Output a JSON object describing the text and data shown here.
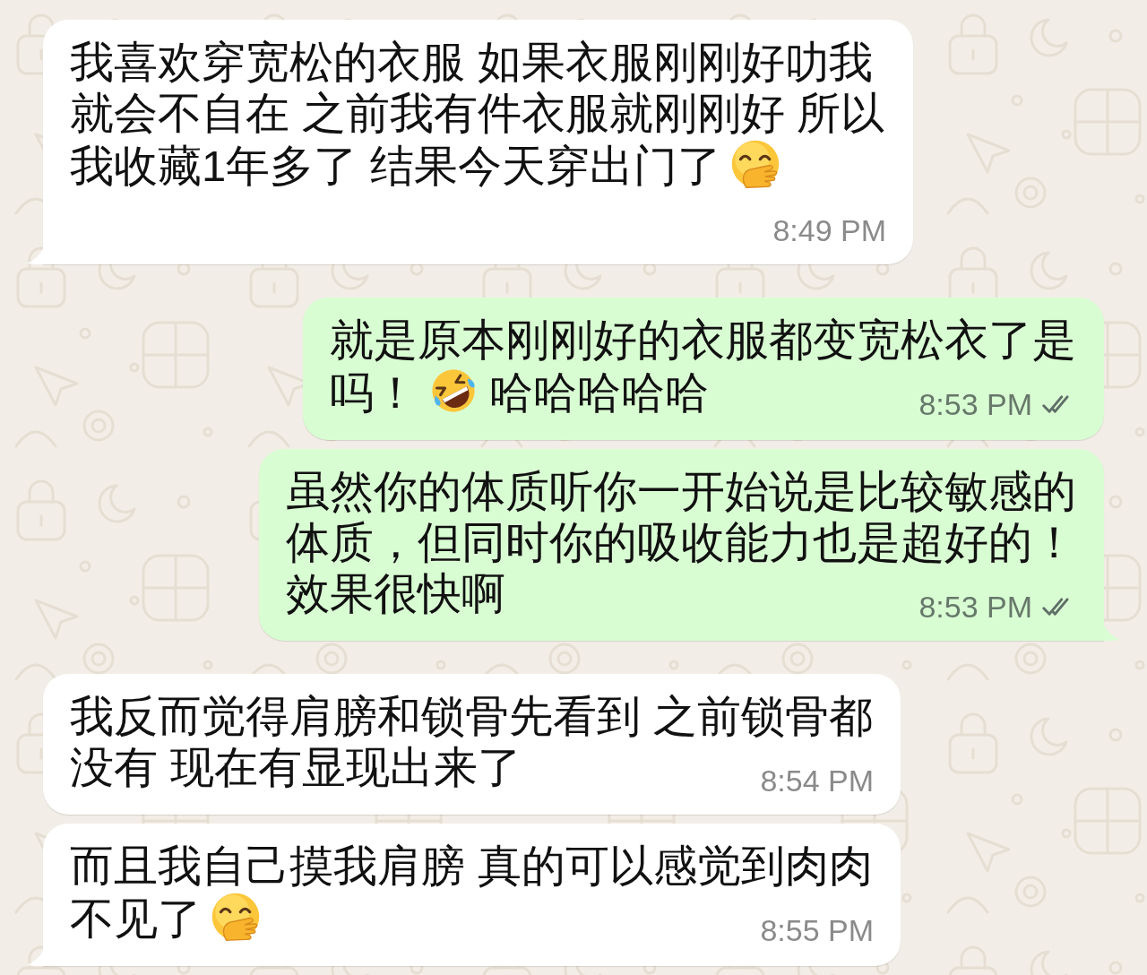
{
  "chat": {
    "messages": [
      {
        "kind": "incoming",
        "tail": true,
        "parts": [
          {
            "kind": "text",
            "text": "我喜欢穿宽松的衣服 如果衣服刚刚好叻我就会不自在 之前我有件衣服就刚刚好 所以我收藏1年多了 结果今天穿出门了"
          },
          {
            "kind": "giggle"
          }
        ],
        "time": "8:49 PM"
      },
      {
        "kind": "outgoing",
        "tail": false,
        "parts": [
          {
            "kind": "text",
            "text": "就是原本刚刚好的衣服都变宽松衣了是吗！"
          },
          {
            "kind": "rofl"
          },
          {
            "kind": "text",
            "text": "哈哈哈哈哈"
          }
        ],
        "time": "8:53 PM",
        "read": false
      },
      {
        "kind": "outgoing",
        "tail": true,
        "parts": [
          {
            "kind": "text",
            "text": "虽然你的体质听你一开始说是比较敏感的体质，但同时你的吸收能力也是超好的！效果很快啊"
          }
        ],
        "time": "8:53 PM",
        "read": false
      },
      {
        "kind": "incoming",
        "tail": false,
        "parts": [
          {
            "kind": "text",
            "text": "我反而觉得肩膀和锁骨先看到 之前锁骨都没有 现在有显现出来了"
          }
        ],
        "time": "8:54 PM"
      },
      {
        "kind": "incoming",
        "tail": true,
        "parts": [
          {
            "kind": "text",
            "text": "而且我自己摸我肩膀 真的可以感觉到肉肉不见了"
          },
          {
            "kind": "giggle"
          }
        ],
        "time": "8:55 PM"
      }
    ]
  }
}
